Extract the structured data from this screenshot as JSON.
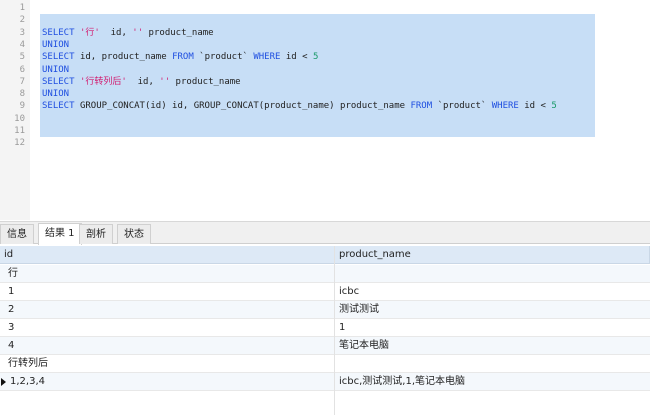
{
  "editor": {
    "line_numbers": [
      "1",
      "2",
      "3",
      "4",
      "5",
      "6",
      "7",
      "8",
      "9",
      "10",
      "11",
      "12"
    ],
    "lines": [
      [],
      [],
      [
        {
          "t": "SELECT ",
          "c": "kw"
        },
        {
          "t": "'行'",
          "c": "str"
        },
        {
          "t": "  id, ",
          "c": ""
        },
        {
          "t": "''",
          "c": "str"
        },
        {
          "t": " product_name",
          "c": ""
        }
      ],
      [
        {
          "t": "UNION",
          "c": "kw"
        }
      ],
      [
        {
          "t": "SELECT ",
          "c": "kw"
        },
        {
          "t": "id, product_name ",
          "c": ""
        },
        {
          "t": "FROM ",
          "c": "kw"
        },
        {
          "t": "`product` ",
          "c": ""
        },
        {
          "t": "WHERE ",
          "c": "kw"
        },
        {
          "t": "id < ",
          "c": ""
        },
        {
          "t": "5",
          "c": "num"
        }
      ],
      [
        {
          "t": "UNION",
          "c": "kw"
        }
      ],
      [
        {
          "t": "SELECT ",
          "c": "kw"
        },
        {
          "t": "'行转列后'",
          "c": "str"
        },
        {
          "t": "  id, ",
          "c": ""
        },
        {
          "t": "''",
          "c": "str"
        },
        {
          "t": " product_name",
          "c": ""
        }
      ],
      [
        {
          "t": "UNION",
          "c": "kw"
        }
      ],
      [
        {
          "t": "SELECT ",
          "c": "kw"
        },
        {
          "t": "GROUP_CONCAT(id) id, GROUP_CONCAT(product_name) product_name ",
          "c": ""
        },
        {
          "t": "FROM ",
          "c": "kw"
        },
        {
          "t": "`product` ",
          "c": ""
        },
        {
          "t": "WHERE ",
          "c": "kw"
        },
        {
          "t": "id < ",
          "c": ""
        },
        {
          "t": "5",
          "c": "num"
        }
      ],
      [],
      [],
      []
    ]
  },
  "tabs": [
    "信息",
    "结果 1",
    "剖析",
    "状态"
  ],
  "active_tab": "结果 1",
  "result": {
    "columns": [
      "id",
      "product_name"
    ],
    "rows": [
      [
        "行",
        ""
      ],
      [
        "1",
        "icbc"
      ],
      [
        "2",
        "测试测试"
      ],
      [
        "3",
        "1"
      ],
      [
        "4",
        "笔记本电脑"
      ],
      [
        "行转列后",
        ""
      ],
      [
        "1,2,3,4",
        "icbc,测试测试,1,笔记本电脑"
      ]
    ]
  },
  "colors": {
    "keyword": "#1f4fe0",
    "string": "#d2196e",
    "number": "#1a9a6a",
    "selection": "#c7def6",
    "grid_header": "#dde9f6"
  }
}
